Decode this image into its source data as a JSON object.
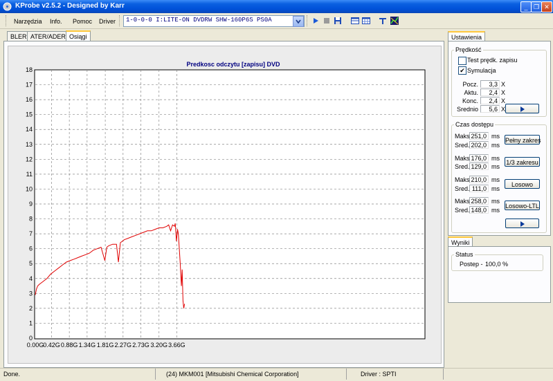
{
  "window": {
    "title": "KProbe v2.5.2 - Designed by Karr"
  },
  "menu": [
    "Narzędzia",
    "Info.",
    "Pomoc",
    "Driver"
  ],
  "drive_select": {
    "value": "1-0-0-0 I:LITE-ON DVDRW SHW-160P6S PS0A"
  },
  "toolbar_icons": [
    "play-icon",
    "stop-icon",
    "save-icon",
    "layout-icon",
    "calendar-icon",
    "tools-icon",
    "chart-icon"
  ],
  "tabs": [
    "BLER",
    "ATER/ADER",
    "Osiągi"
  ],
  "active_tab": "Osiągi",
  "chart_data": {
    "type": "line",
    "title": "Predkosc odczytu [zapisu] DVD",
    "xlabel": "",
    "ylabel": "",
    "ylim": [
      0,
      18
    ],
    "yticks": [
      "0",
      "1",
      "2",
      "3",
      "4",
      "5",
      "6",
      "7",
      "8",
      "9",
      "10",
      "11",
      "12",
      "13",
      "14",
      "15",
      "16",
      "17",
      "18"
    ],
    "xlim": [
      0,
      10.08
    ],
    "xticks": [
      "0.00G",
      "0.42G",
      "0.88G",
      "1.34G",
      "1.81G",
      "2.27G",
      "2.73G",
      "3.20G",
      "3.66G"
    ],
    "xtick_positions": [
      0,
      0.42,
      0.88,
      1.34,
      1.81,
      2.27,
      2.73,
      3.2,
      3.66
    ],
    "grid": true,
    "line_color": "#e00000",
    "series": [
      {
        "x": [
          0.0,
          0.03,
          0.06,
          0.1,
          0.2,
          0.3,
          0.4,
          0.5,
          0.6,
          0.7,
          0.8,
          0.9,
          1.0,
          1.1,
          1.2,
          1.3,
          1.4,
          1.5,
          1.6,
          1.7,
          1.8,
          1.85,
          1.9,
          2.0,
          2.1,
          2.15,
          2.2,
          2.25,
          2.3,
          2.4,
          2.5,
          2.6,
          2.7,
          2.8,
          2.9,
          3.0,
          3.1,
          3.2,
          3.3,
          3.4,
          3.45,
          3.5,
          3.55,
          3.6,
          3.62,
          3.65,
          3.68,
          3.7,
          3.75,
          3.78,
          3.8,
          3.82,
          3.84,
          3.86
        ],
        "y": [
          2.9,
          3.3,
          3.5,
          3.6,
          3.8,
          4.0,
          4.3,
          4.5,
          4.7,
          4.9,
          5.1,
          5.2,
          5.3,
          5.4,
          5.5,
          5.6,
          5.7,
          5.9,
          6.0,
          6.1,
          5.2,
          6.1,
          6.2,
          6.3,
          6.3,
          5.1,
          6.4,
          6.5,
          6.6,
          6.7,
          6.8,
          6.9,
          7.0,
          7.1,
          7.2,
          7.2,
          7.3,
          7.4,
          7.4,
          7.5,
          7.6,
          7.2,
          7.6,
          7.5,
          7.7,
          6.5,
          7.3,
          7.0,
          5.0,
          3.5,
          4.6,
          2.5,
          2.0,
          2.3
        ]
      }
    ]
  },
  "settings": {
    "tab": "Ustawienia",
    "speed_group": "Prędkość",
    "test_write_label": "Test prędk. zapisu",
    "test_write_checked": false,
    "simulation_label": "Symulacja",
    "simulation_checked": true,
    "speeds": [
      {
        "label": "Pocz.",
        "value": "3,3",
        "unit": "X"
      },
      {
        "label": "Aktu.",
        "value": "2,4",
        "unit": "X"
      },
      {
        "label": "Konc.",
        "value": "2,4",
        "unit": "X"
      },
      {
        "label": "Srednio",
        "value": "5,6",
        "unit": "X"
      }
    ],
    "access_group": "Czas dostępu",
    "access": [
      {
        "max_label": "Maks.",
        "max": "251,0",
        "avg_label": "Sred.",
        "avg": "202,0",
        "unit": "ms",
        "button": "Pełny zakres"
      },
      {
        "max_label": "Maks.",
        "max": "176,0",
        "avg_label": "Sred.",
        "avg": "129,0",
        "unit": "ms",
        "button": "1/3 zakresu"
      },
      {
        "max_label": "Maks.",
        "max": "210,0",
        "avg_label": "Sred.",
        "avg": "111,0",
        "unit": "ms",
        "button": "Losowo"
      },
      {
        "max_label": "Maks.",
        "max": "258,0",
        "avg_label": "Sred.",
        "avg": "148,0",
        "unit": "ms",
        "button": "Losowo-LTL"
      }
    ]
  },
  "results": {
    "tab": "Wyniki",
    "status_group": "Status",
    "progress_label": "Postep -",
    "progress_value": "100,0 %"
  },
  "statusbar": {
    "left": "Done.",
    "media": "(24) MKM001 [Mitsubishi Chemical Corporation]",
    "driver": "Driver : SPTI"
  }
}
